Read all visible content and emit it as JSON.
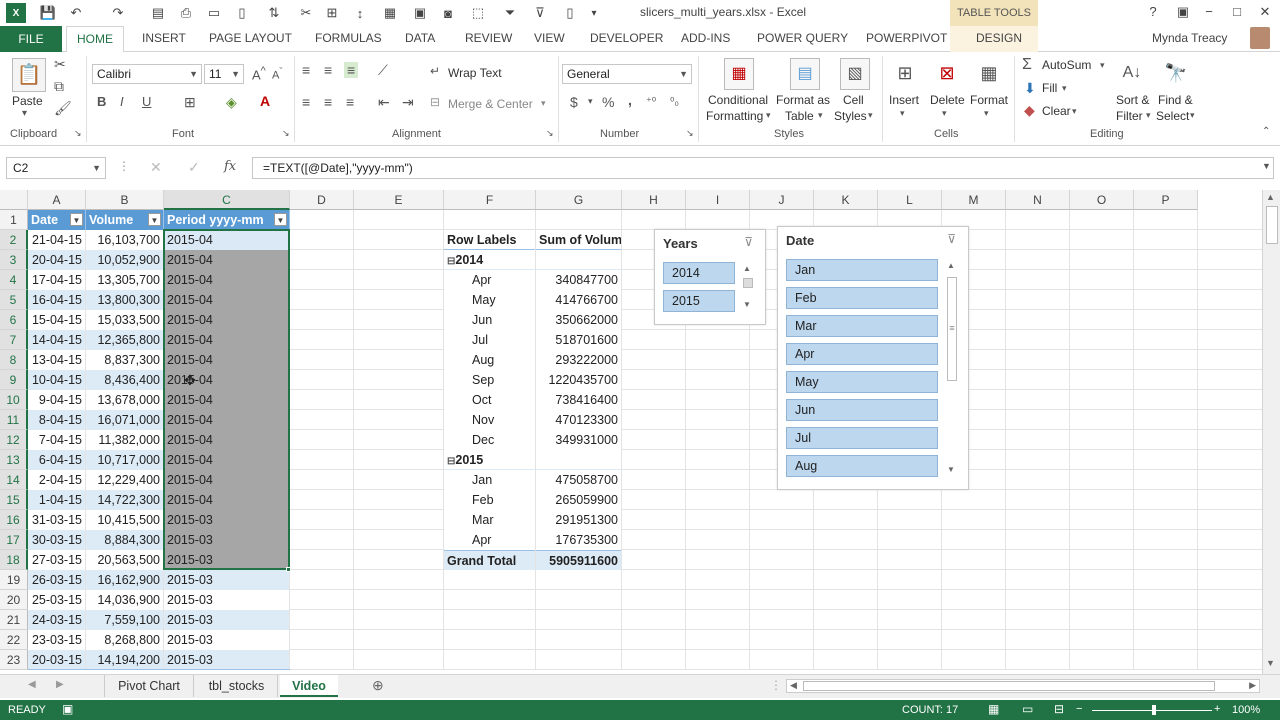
{
  "window": {
    "title": "slicers_multi_years.xlsx - Excel",
    "table_tools": "TABLE TOOLS",
    "user": "Mynda Treacy",
    "controls": [
      "?",
      "−",
      "□",
      "✕"
    ]
  },
  "ribbon_tabs": [
    "FILE",
    "HOME",
    "INSERT",
    "PAGE LAYOUT",
    "FORMULAS",
    "DATA",
    "REVIEW",
    "VIEW",
    "DEVELOPER",
    "ADD-INS",
    "POWER QUERY",
    "POWERPIVOT",
    "DESIGN"
  ],
  "ribbon": {
    "clipboard": {
      "paste": "Paste",
      "label": "Clipboard"
    },
    "font": {
      "name": "Calibri",
      "size": "11",
      "label": "Font"
    },
    "alignment": {
      "wrap": "Wrap Text",
      "merge": "Merge & Center",
      "label": "Alignment"
    },
    "number": {
      "format": "General",
      "label": "Number",
      "currency": "$",
      "percent": "%",
      "comma": ","
    },
    "styles": {
      "conditional": "Conditional",
      "formatting": "Formatting",
      "format_as": "Format as",
      "table": "Table",
      "cell": "Cell",
      "styles_word": "Styles",
      "label": "Styles"
    },
    "cells": {
      "insert": "Insert",
      "delete": "Delete",
      "format": "Format",
      "label": "Cells"
    },
    "editing": {
      "autosum": "AutoSum",
      "fill": "Fill",
      "clear": "Clear",
      "sort": "Sort &",
      "filter": "Filter",
      "find": "Find &",
      "select": "Select",
      "label": "Editing"
    }
  },
  "formula_bar": {
    "name_box": "C2",
    "fx": "fx",
    "formula": "=TEXT([@Date],\"yyyy-mm\")"
  },
  "columns": [
    "A",
    "B",
    "C",
    "D",
    "E",
    "F",
    "G",
    "H",
    "I",
    "J",
    "K",
    "L",
    "M",
    "N",
    "O",
    "P"
  ],
  "rows": [
    "1",
    "2",
    "3",
    "4",
    "5",
    "6",
    "7",
    "8",
    "9",
    "10",
    "11",
    "12",
    "13",
    "14",
    "15",
    "16",
    "17",
    "18",
    "19",
    "20",
    "21",
    "22",
    "23"
  ],
  "table": {
    "headers": [
      "Date",
      "Volume",
      "Period yyyy-mm"
    ],
    "rows": [
      [
        "21-04-15",
        "16,103,700",
        "2015-04"
      ],
      [
        "20-04-15",
        "10,052,900",
        "2015-04"
      ],
      [
        "17-04-15",
        "13,305,700",
        "2015-04"
      ],
      [
        "16-04-15",
        "13,800,300",
        "2015-04"
      ],
      [
        "15-04-15",
        "15,033,500",
        "2015-04"
      ],
      [
        "14-04-15",
        "12,365,800",
        "2015-04"
      ],
      [
        "13-04-15",
        "8,837,300",
        "2015-04"
      ],
      [
        "10-04-15",
        "8,436,400",
        "2015-04"
      ],
      [
        "9-04-15",
        "13,678,000",
        "2015-04"
      ],
      [
        "8-04-15",
        "16,071,000",
        "2015-04"
      ],
      [
        "7-04-15",
        "11,382,000",
        "2015-04"
      ],
      [
        "6-04-15",
        "10,717,000",
        "2015-04"
      ],
      [
        "2-04-15",
        "12,229,400",
        "2015-04"
      ],
      [
        "1-04-15",
        "14,722,300",
        "2015-04"
      ],
      [
        "31-03-15",
        "10,415,500",
        "2015-03"
      ],
      [
        "30-03-15",
        "8,884,300",
        "2015-03"
      ],
      [
        "27-03-15",
        "20,563,500",
        "2015-03"
      ],
      [
        "26-03-15",
        "16,162,900",
        "2015-03"
      ],
      [
        "25-03-15",
        "14,036,900",
        "2015-03"
      ],
      [
        "24-03-15",
        "7,559,100",
        "2015-03"
      ],
      [
        "23-03-15",
        "8,268,800",
        "2015-03"
      ],
      [
        "20-03-15",
        "14,194,200",
        "2015-03"
      ]
    ]
  },
  "pivot": {
    "row_labels": "Row Labels",
    "sum_header": "Sum of Volume",
    "groups": [
      {
        "year": "2014",
        "items": [
          [
            "Apr",
            "340847700"
          ],
          [
            "May",
            "414766700"
          ],
          [
            "Jun",
            "350662000"
          ],
          [
            "Jul",
            "518701600"
          ],
          [
            "Aug",
            "293222000"
          ],
          [
            "Sep",
            "1220435700"
          ],
          [
            "Oct",
            "738416400"
          ],
          [
            "Nov",
            "470123300"
          ],
          [
            "Dec",
            "349931000"
          ]
        ]
      },
      {
        "year": "2015",
        "items": [
          [
            "Jan",
            "475058700"
          ],
          [
            "Feb",
            "265059900"
          ],
          [
            "Mar",
            "291951300"
          ],
          [
            "Apr",
            "176735300"
          ]
        ]
      }
    ],
    "grand_total_label": "Grand Total",
    "grand_total": "5905911600"
  },
  "slicer_years": {
    "title": "Years",
    "items": [
      "2014",
      "2015"
    ]
  },
  "slicer_date": {
    "title": "Date",
    "items": [
      "Jan",
      "Feb",
      "Mar",
      "Apr",
      "May",
      "Jun",
      "Jul",
      "Aug"
    ]
  },
  "sheet_tabs": [
    "Pivot Chart",
    "tbl_stocks",
    "Video"
  ],
  "status": {
    "ready": "READY",
    "count": "COUNT: 17",
    "zoom": "100%"
  },
  "colors": {
    "excel_green": "#217346",
    "table_header": "#5b9bd5",
    "band": "#ddebf7",
    "slicer_item": "#bdd7ee"
  }
}
